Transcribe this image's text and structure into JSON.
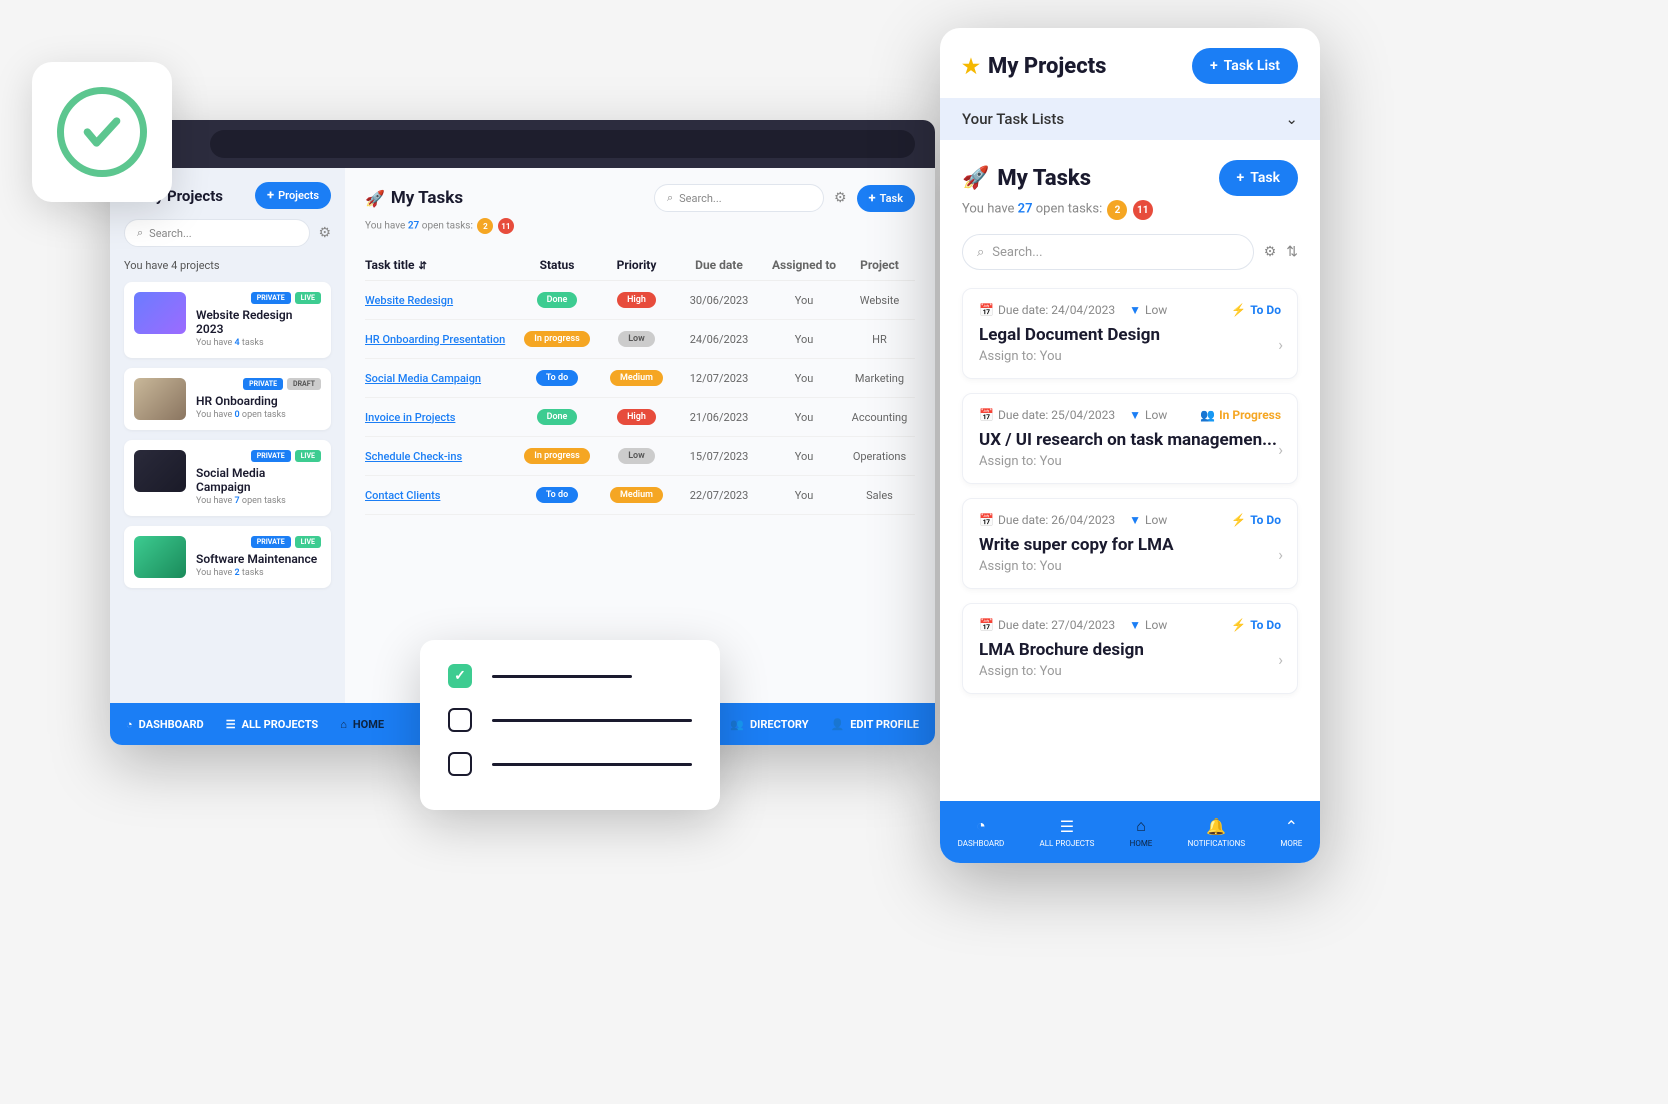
{
  "sidebar": {
    "title": "My Projects",
    "projects_btn": "Projects",
    "search_placeholder": "Search...",
    "count_text": "You have 4 projects",
    "cards": [
      {
        "name": "Website Redesign 2023",
        "tags": [
          "PRIVATE",
          "LIVE"
        ],
        "sub_pre": "You have ",
        "sub_num": "4",
        "sub_post": " tasks"
      },
      {
        "name": "HR Onboarding",
        "tags": [
          "PRIVATE",
          "DRAFT"
        ],
        "sub_pre": "You have ",
        "sub_num": "0",
        "sub_post": " open tasks"
      },
      {
        "name": "Social Media Campaign",
        "tags": [
          "PRIVATE",
          "LIVE"
        ],
        "sub_pre": "You have ",
        "sub_num": "7",
        "sub_post": " open tasks"
      },
      {
        "name": "Software Maintenance",
        "tags": [
          "PRIVATE",
          "LIVE"
        ],
        "sub_pre": "You have ",
        "sub_num": "2",
        "sub_post": " tasks"
      }
    ]
  },
  "main": {
    "title": "My Tasks",
    "task_btn": "Task",
    "search_placeholder": "Search...",
    "open_pre": "You have ",
    "open_num": "27",
    "open_post": " open tasks:",
    "badge1": "2",
    "badge2": "11",
    "cols": {
      "title": "Task title",
      "status": "Status",
      "priority": "Priority",
      "date": "Due date",
      "assigned": "Assigned to",
      "project": "Project"
    },
    "rows": [
      {
        "title": "Website Redesign",
        "status": "Done",
        "priority": "High",
        "date": "30/06/2023",
        "assigned": "You",
        "project": "Website"
      },
      {
        "title": "HR Onboarding Presentation",
        "status": "In progress",
        "priority": "Low",
        "date": "24/06/2023",
        "assigned": "You",
        "project": "HR"
      },
      {
        "title": "Social Media Campaign",
        "status": "To do",
        "priority": "Medium",
        "date": "12/07/2023",
        "assigned": "You",
        "project": "Marketing"
      },
      {
        "title": "Invoice in Projects",
        "status": "Done",
        "priority": "High",
        "date": "21/06/2023",
        "assigned": "You",
        "project": "Accounting"
      },
      {
        "title": "Schedule Check-ins",
        "status": "In progress",
        "priority": "Low",
        "date": "15/07/2023",
        "assigned": "You",
        "project": "Operations"
      },
      {
        "title": "Contact Clients",
        "status": "To do",
        "priority": "Medium",
        "date": "22/07/2023",
        "assigned": "You",
        "project": "Sales"
      }
    ]
  },
  "bottomnav": {
    "dashboard": "DASHBOARD",
    "all_projects": "ALL PROJECTS",
    "home": "HOME",
    "directory": "DIRECTORY",
    "edit_profile": "EDIT PROFILE"
  },
  "mobile": {
    "header_title": "My Projects",
    "task_list_btn": "Task List",
    "section": "Your Task Lists",
    "tasks_title": "My Tasks",
    "task_btn": "Task",
    "open_pre": "You have ",
    "open_num": "27",
    "open_post": " open tasks:",
    "badge1": "2",
    "badge2": "11",
    "search_placeholder": "Search...",
    "assign_label": "Assign to: You",
    "due_label": "Due date: ",
    "cards": [
      {
        "date": "24/04/2023",
        "priority": "Low",
        "status": "To Do",
        "status_type": "todo",
        "title": "Legal Document Design"
      },
      {
        "date": "25/04/2023",
        "priority": "Low",
        "status": "In Progress",
        "status_type": "progress",
        "title": "UX / UI research on task managemen..."
      },
      {
        "date": "26/04/2023",
        "priority": "Low",
        "status": "To Do",
        "status_type": "todo",
        "title": "Write super copy for LMA"
      },
      {
        "date": "27/04/2023",
        "priority": "Low",
        "status": "To Do",
        "status_type": "todo",
        "title": "LMA Brochure design"
      }
    ],
    "nav": {
      "dashboard": "DASHBOARD",
      "all_projects": "ALL PROJECTS",
      "home": "HOME",
      "notifications": "NOTIFICATIONS",
      "more": "MORE"
    }
  }
}
